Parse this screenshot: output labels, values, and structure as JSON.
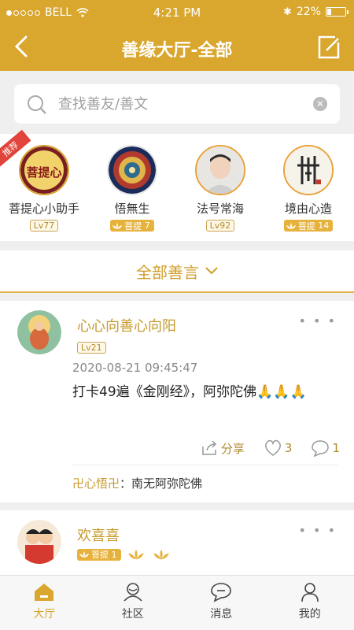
{
  "status_bar": {
    "carrier": "BELL",
    "time": "4:21 PM",
    "battery": "22%",
    "battery_level": 0.22
  },
  "nav": {
    "title": "善缘大厅-全部",
    "back_icon": "chevron-left-icon",
    "compose_icon": "compose-icon"
  },
  "search": {
    "placeholder": "查找善友/善文"
  },
  "friends": {
    "badge": "推荐",
    "items": [
      {
        "name": "菩提心小助手",
        "level": "Lv77",
        "avatar_text": "菩提心"
      },
      {
        "name": "悟無生",
        "badge": "菩提",
        "badge_num": "7"
      },
      {
        "name": "法号常海",
        "level": "Lv92"
      },
      {
        "name": "境由心造",
        "badge": "菩提",
        "badge_num": "14"
      }
    ]
  },
  "filter": {
    "label": "全部善言"
  },
  "posts": [
    {
      "author": "心心向善心向阳",
      "level": "Lv21",
      "time": "2020-08-21 09:45:47",
      "text": "打卡49遍《金刚经》，阿弥陀佛🙏🙏🙏",
      "share": "分享",
      "likes": "3",
      "comments": "1",
      "comment_author": "卍心悟卍",
      "comment_text": "南无阿弥陀佛"
    },
    {
      "author": "欢喜喜",
      "badge": "菩提",
      "badge_num": "1"
    }
  ],
  "tabbar": {
    "tabs": [
      "大厅",
      "社区",
      "消息",
      "我的"
    ],
    "active": 0
  },
  "colors": {
    "brand": "#d9a62e",
    "accent_text": "#c69a2c"
  }
}
